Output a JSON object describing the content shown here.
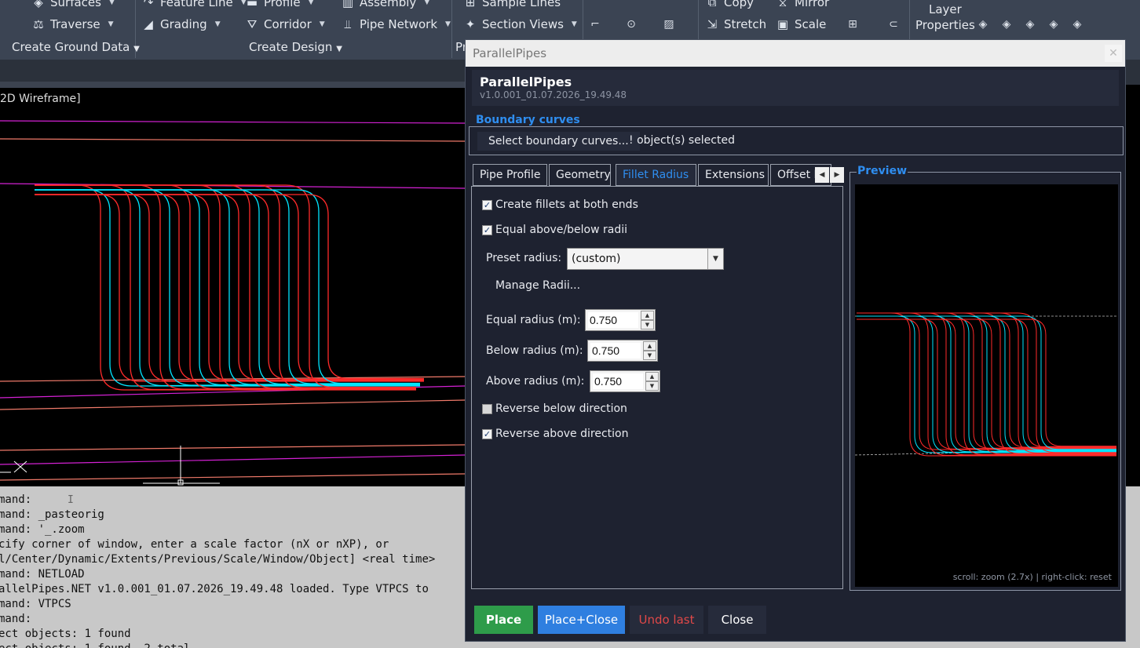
{
  "ribbon": {
    "items": {
      "surfaces": "Surfaces",
      "traverse": "Traverse",
      "feature_line": "Feature Line",
      "grading": "Grading",
      "profile": "Profile",
      "corridor": "Corridor",
      "assembly": "Assembly",
      "pipe_network": "Pipe Network",
      "sample_lines": "Sample Lines",
      "section_views": "Section Views",
      "copy": "Copy",
      "mirror": "Mirror",
      "stretch": "Stretch",
      "scale": "Scale",
      "layer_properties_1": "Layer",
      "layer_properties_2": "Properties"
    },
    "groups": {
      "create_ground_data": "Create Ground Data",
      "create_design": "Create Design",
      "profile_section_partial": "Pr"
    }
  },
  "viewport": {
    "label": "2D Wireframe]"
  },
  "command_line": {
    "lines": [
      "mand:",
      "mand: _pasteorig",
      "mand: '_.zoom",
      "cify corner of window, enter a scale factor (nX or nXP), or",
      "l/Center/Dynamic/Extents/Previous/Scale/Window/Object] <real time>",
      "mand: NETLOAD",
      "allelPipes.NET v1.0.001_01.07.2026_19.49.48 loaded. Type VTPCS to",
      "mand: VTPCS",
      "mand:",
      "ect objects: 1 found",
      "ect objects: 1 found, 2 total"
    ]
  },
  "dialog": {
    "window_title": "ParallelPipes",
    "title": "ParallelPipes",
    "version": "v1.0.001_01.07.2026_19.49.48",
    "boundary": {
      "legend": "Boundary curves",
      "select_button": "Select boundary curves...",
      "status": "! object(s) selected"
    },
    "tabs": [
      {
        "label": "Pipe Profile"
      },
      {
        "label": "Geometry"
      },
      {
        "label": "Fillet Radius"
      },
      {
        "label": "Extensions"
      },
      {
        "label": "Offset L"
      }
    ],
    "fillet": {
      "create_fillets": "Create fillets at both ends",
      "create_fillets_checked": true,
      "equal_radii": "Equal above/below radii",
      "equal_radii_checked": true,
      "preset_label": "Preset radius:",
      "preset_value": "(custom)",
      "manage_radii": "Manage Radii...",
      "equal_radius_label": "Equal radius (m):",
      "equal_radius_value": "0.750",
      "below_radius_label": "Below radius (m):",
      "below_radius_value": "0.750",
      "above_radius_label": "Above radius (m):",
      "above_radius_value": "0.750",
      "reverse_below": "Reverse below direction",
      "reverse_below_checked": false,
      "reverse_above": "Reverse above direction",
      "reverse_above_checked": true
    },
    "preview": {
      "legend": "Preview",
      "hint": "scroll: zoom (2.7x)  |  right-click: reset"
    },
    "buttons": {
      "place": "Place",
      "place_close": "Place+Close",
      "undo_last": "Undo last",
      "close": "Close"
    }
  },
  "colors": {
    "place_green": "#2e9c4a",
    "place_close_blue": "#2f7fe0",
    "undo_red": "#e04848",
    "accent_blue": "#2f8ef0",
    "pipe_red": "#ff2a2a",
    "pipe_cyan": "#00e5ff",
    "line_magenta": "#d421d4",
    "line_salmon": "#f07a6a"
  }
}
